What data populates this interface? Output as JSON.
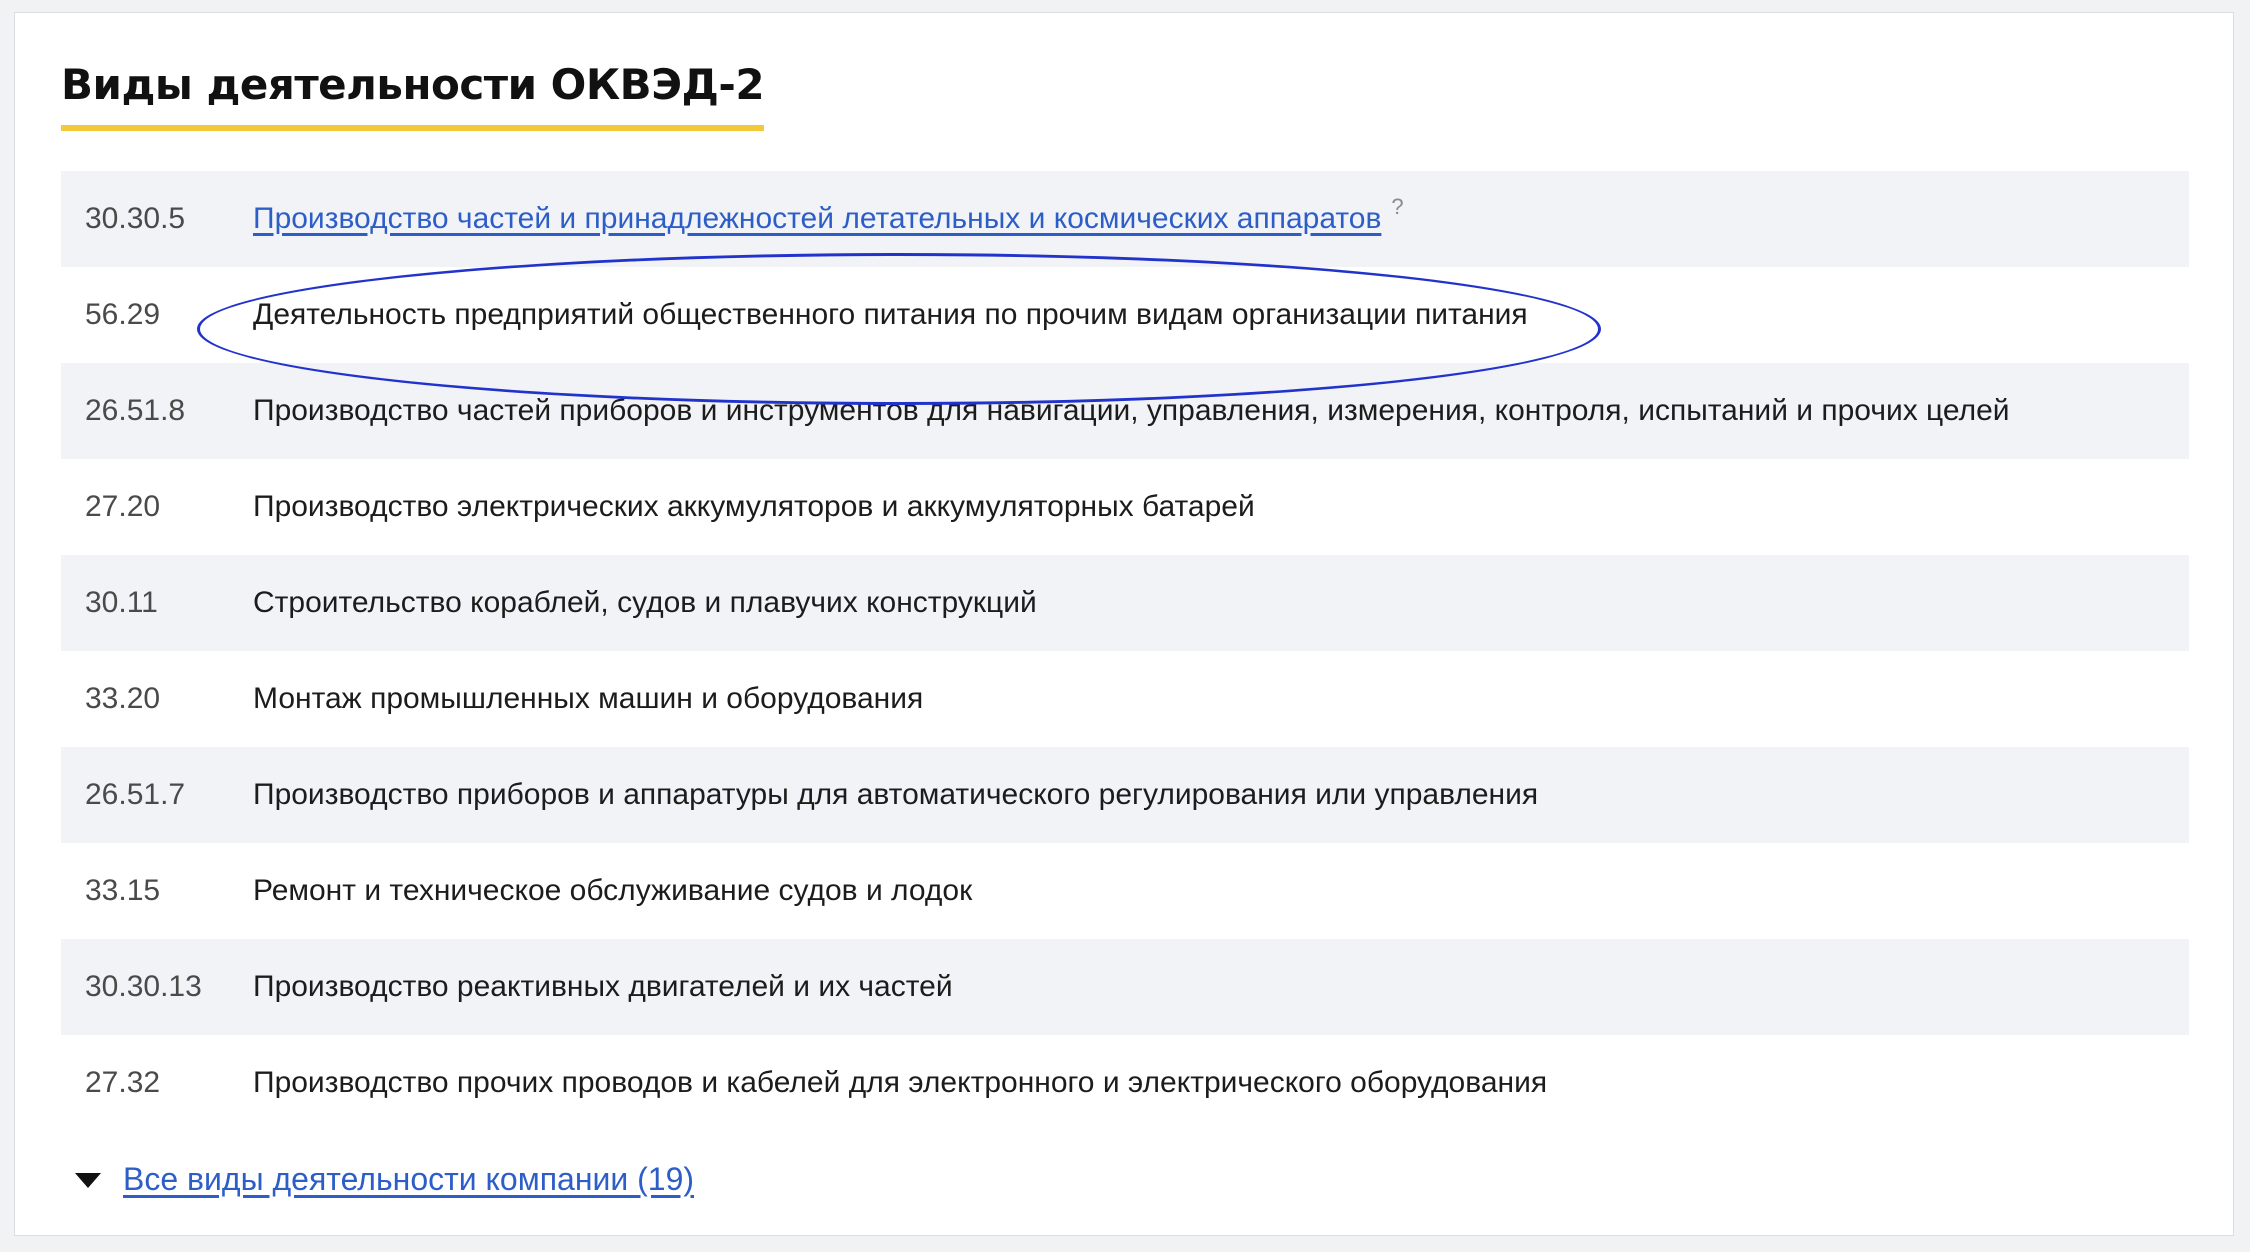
{
  "section": {
    "title": "Виды деятельности ОКВЭД-2"
  },
  "activities": [
    {
      "code": "30.30.5",
      "name": "Производство частей и принадлежностей летательных и космических аппаратов",
      "help": "?"
    },
    {
      "code": "56.29",
      "name": "Деятельность предприятий общественного питания по прочим видам организации питания"
    },
    {
      "code": "26.51.8",
      "name": "Производство частей приборов и инструментов для навигации, управления, измерения, контроля, испытаний и прочих целей"
    },
    {
      "code": "27.20",
      "name": "Производство электрических аккумуляторов и аккумуляторных батарей"
    },
    {
      "code": "30.11",
      "name": "Строительство кораблей, судов и плавучих конструкций"
    },
    {
      "code": "33.20",
      "name": "Монтаж промышленных машин и оборудования"
    },
    {
      "code": "26.51.7",
      "name": "Производство приборов и аппаратуры для автоматического регулирования или управления"
    },
    {
      "code": "33.15",
      "name": "Ремонт и техническое обслуживание судов и лодок"
    },
    {
      "code": "30.30.13",
      "name": "Производство реактивных двигателей и их частей"
    },
    {
      "code": "27.32",
      "name": "Производство прочих проводов и кабелей для электронного и электрического оборудования"
    }
  ],
  "expand": {
    "icon": "triangle-down-icon",
    "label": "Все виды деятельности компании (19)"
  },
  "colors": {
    "accent_underline": "#f3c93c",
    "link": "#2d5ec8",
    "highlight_ellipse": "#2233cc",
    "row_shade": "#f2f3f6"
  }
}
